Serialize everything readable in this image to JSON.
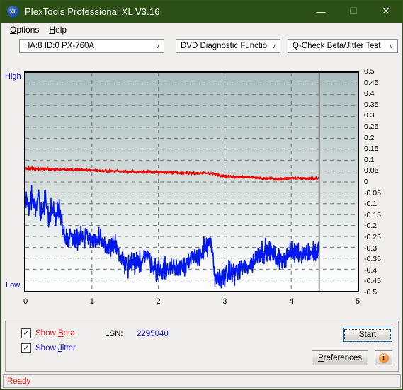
{
  "window": {
    "title": "PlexTools Professional XL V3.16",
    "icon": "XL",
    "minimize": "—",
    "maximize": "☐",
    "close": "✕"
  },
  "menubar": {
    "items": [
      {
        "pre": "",
        "accel": "O",
        "post": "ptions"
      },
      {
        "pre": "",
        "accel": "H",
        "post": "elp"
      }
    ]
  },
  "toolbar": {
    "drive": "HA:8 ID:0  PX-760A",
    "function": "DVD Diagnostic Functions",
    "test": "Q-Check Beta/Jitter Test",
    "arrow": "∨"
  },
  "chart_panel": {
    "label_high": "High",
    "label_low": "Low"
  },
  "controls": {
    "show_beta": {
      "pre": "Show ",
      "accel": "B",
      "post": "eta"
    },
    "show_jitter": {
      "pre": "Show ",
      "accel": "J",
      "post": "itter"
    },
    "checked_mark": "✓",
    "lsn_label": "LSN:",
    "lsn_value": "2295040",
    "start": {
      "pre": "",
      "accel": "S",
      "post": "tart"
    },
    "preferences": {
      "pre": "",
      "accel": "P",
      "post": "references"
    },
    "info_glyph": "i"
  },
  "statusbar": {
    "text": "Ready"
  },
  "colors": {
    "titlebar": "#2d5016",
    "beta": "#ee0000",
    "jitter": "#0018ee",
    "axis_label": "#0000cc",
    "status_text": "#e02020"
  },
  "chart_data": {
    "type": "line",
    "title": "Q-Check Beta/Jitter Test",
    "xlabel": "",
    "ylabel": "",
    "xlim": [
      0,
      5
    ],
    "ylim": [
      -0.5,
      0.5
    ],
    "xticks": [
      0,
      1,
      2,
      3,
      4,
      5
    ],
    "yticks": [
      0.5,
      0.45,
      0.4,
      0.35,
      0.3,
      0.25,
      0.2,
      0.15,
      0.1,
      0.05,
      0,
      -0.05,
      -0.1,
      -0.15,
      -0.2,
      -0.25,
      -0.3,
      -0.35,
      -0.4,
      -0.45,
      -0.5
    ],
    "grid": true,
    "legend": [
      "Show Beta",
      "Show Jitter"
    ],
    "legend_position": "below-left",
    "data_end_x": 4.42,
    "series": [
      {
        "name": "Beta",
        "color": "#ee0000",
        "x": [
          0.0,
          0.1,
          0.2,
          0.3,
          0.4,
          0.5,
          0.6,
          0.7,
          0.8,
          0.9,
          1.0,
          1.1,
          1.2,
          1.3,
          1.4,
          1.5,
          1.6,
          1.7,
          1.8,
          1.9,
          2.0,
          2.1,
          2.2,
          2.3,
          2.4,
          2.5,
          2.6,
          2.7,
          2.8,
          2.9,
          3.0,
          3.1,
          3.2,
          3.3,
          3.4,
          3.5,
          3.6,
          3.7,
          3.8,
          3.9,
          4.0,
          4.1,
          4.2,
          4.3,
          4.42
        ],
        "values": [
          0.06,
          0.062,
          0.058,
          0.06,
          0.059,
          0.057,
          0.057,
          0.056,
          0.055,
          0.054,
          0.054,
          0.052,
          0.051,
          0.05,
          0.049,
          0.047,
          0.046,
          0.048,
          0.047,
          0.045,
          0.044,
          0.045,
          0.043,
          0.042,
          0.041,
          0.04,
          0.039,
          0.04,
          0.038,
          0.03,
          0.026,
          0.024,
          0.022,
          0.022,
          0.021,
          0.018,
          0.016,
          0.015,
          0.014,
          0.015,
          0.018,
          0.017,
          0.016,
          0.016,
          0.016
        ],
        "noise": 0.004
      },
      {
        "name": "Jitter",
        "color": "#0018ee",
        "x": [
          0.0,
          0.05,
          0.1,
          0.15,
          0.2,
          0.25,
          0.3,
          0.35,
          0.4,
          0.45,
          0.5,
          0.55,
          0.58,
          0.62,
          0.7,
          0.8,
          0.9,
          1.0,
          1.05,
          1.1,
          1.2,
          1.3,
          1.35,
          1.4,
          1.5,
          1.55,
          1.6,
          1.7,
          1.8,
          1.9,
          1.95,
          2.0,
          2.1,
          2.2,
          2.3,
          2.4,
          2.5,
          2.6,
          2.7,
          2.75,
          2.8,
          2.85,
          2.9,
          3.0,
          3.1,
          3.2,
          3.3,
          3.4,
          3.5,
          3.55,
          3.6,
          3.7,
          3.8,
          3.9,
          3.95,
          4.0,
          4.1,
          4.2,
          4.3,
          4.42
        ],
        "values": [
          -0.055,
          -0.12,
          -0.06,
          -0.14,
          -0.07,
          -0.15,
          -0.08,
          -0.17,
          -0.095,
          -0.185,
          -0.11,
          -0.2,
          -0.24,
          -0.255,
          -0.25,
          -0.255,
          -0.248,
          -0.255,
          -0.27,
          -0.268,
          -0.3,
          -0.29,
          -0.28,
          -0.33,
          -0.38,
          -0.385,
          -0.38,
          -0.375,
          -0.33,
          -0.37,
          -0.4,
          -0.405,
          -0.4,
          -0.395,
          -0.39,
          -0.37,
          -0.36,
          -0.34,
          -0.305,
          -0.29,
          -0.295,
          -0.44,
          -0.445,
          -0.43,
          -0.415,
          -0.405,
          -0.39,
          -0.38,
          -0.33,
          -0.32,
          -0.315,
          -0.32,
          -0.36,
          -0.345,
          -0.33,
          -0.325,
          -0.32,
          -0.33,
          -0.325,
          -0.32
        ],
        "noise": 0.03
      }
    ]
  }
}
